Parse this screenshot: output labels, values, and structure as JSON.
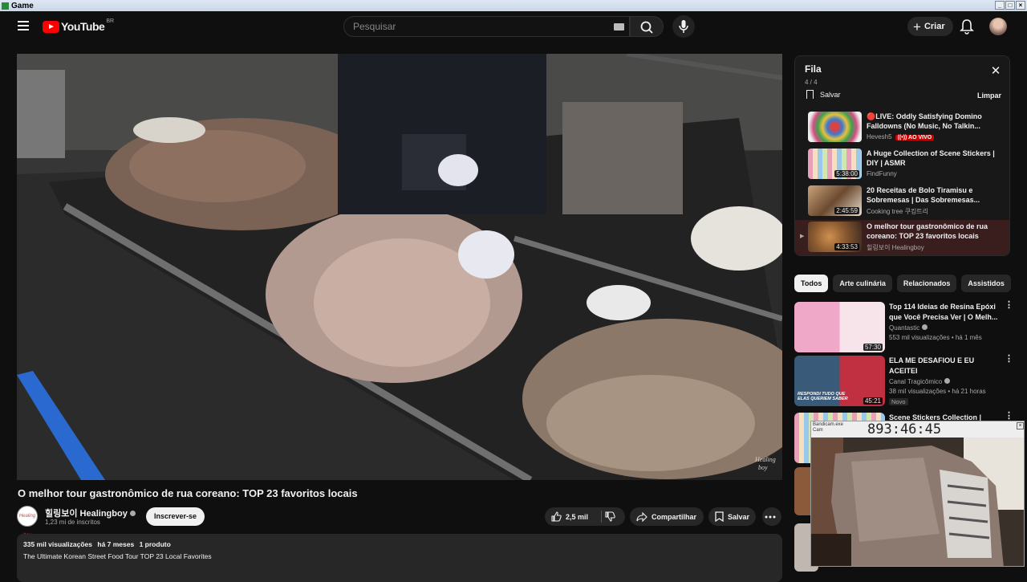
{
  "window": {
    "title": "Game",
    "controls": [
      "_",
      "□",
      "×"
    ]
  },
  "header": {
    "brand": "YouTube",
    "region": "BR",
    "search_placeholder": "Pesquisar",
    "create_label": "Criar"
  },
  "video": {
    "title": "O melhor tour gastronômico de rua coreano: TOP 23 favoritos locais",
    "watermark": "Healing\nboy",
    "channel": {
      "name": "힐링보이 Healingboy",
      "subscribers": "1,23 mi de inscritos",
      "avatar_text": "Healing boy"
    },
    "subscribe_label": "Inscrever-se",
    "likes": "2,5 mil",
    "share_label": "Compartilhar",
    "save_label": "Salvar",
    "description": {
      "views": "335 mil visualizações",
      "age": "há 7 meses",
      "products": "1 produto",
      "line": "The Ultimate Korean Street Food Tour TOP 23 Local Favorites"
    }
  },
  "queue": {
    "title": "Fila",
    "count": "4 / 4",
    "save_label": "Salvar",
    "clear_label": "Limpar",
    "items": [
      {
        "title": "🔴LIVE: Oddly Satisfying Domino Falldowns (No Music, No Talkin...",
        "channel": "Hevesh5",
        "badge": "((•)) AO VIVO",
        "duration": ""
      },
      {
        "title": "A Huge Collection of Scene Stickers | DIY | ASMR",
        "channel": "FindFunny",
        "badge": "",
        "duration": "5:38:00"
      },
      {
        "title": "20 Receitas de Bolo Tiramisu e Sobremesas | Das Sobremesas...",
        "channel": "Cooking tree 쿠킹트리",
        "badge": "",
        "duration": "2:45:59"
      },
      {
        "title": "O melhor tour gastronômico de rua coreano: TOP 23 favoritos locais",
        "channel": "힐링보이 Healingboy",
        "badge": "",
        "duration": "4:33:53"
      }
    ]
  },
  "chips": [
    "Todos",
    "Arte culinária",
    "Relacionados",
    "Assistidos"
  ],
  "recommendations": [
    {
      "title": "Top 114 Ideias de Resina Epóxi que Você Precisa Ver | O Melh...",
      "channel": "Quantastic",
      "stats": "553 mil visualizações • há 1 mês",
      "duration": "57:30",
      "tag": ""
    },
    {
      "title": "ELA ME DESAFIOU E EU ACEITEI",
      "channel": "Canal Tragicômico",
      "stats": "38 mil visualizações • há 21 horas",
      "duration": "45:21",
      "tag": "Novo",
      "thumb_text": "RESPONDI TUDO QUE ELAS QUERIEM SABER"
    },
    {
      "title": "Scene Stickers Collection | ASMR",
      "channel": "",
      "stats": "",
      "duration": "",
      "tag": ""
    }
  ],
  "camera": {
    "timer": "893:46:45",
    "caption": "Bandicam.exe\nCam"
  }
}
